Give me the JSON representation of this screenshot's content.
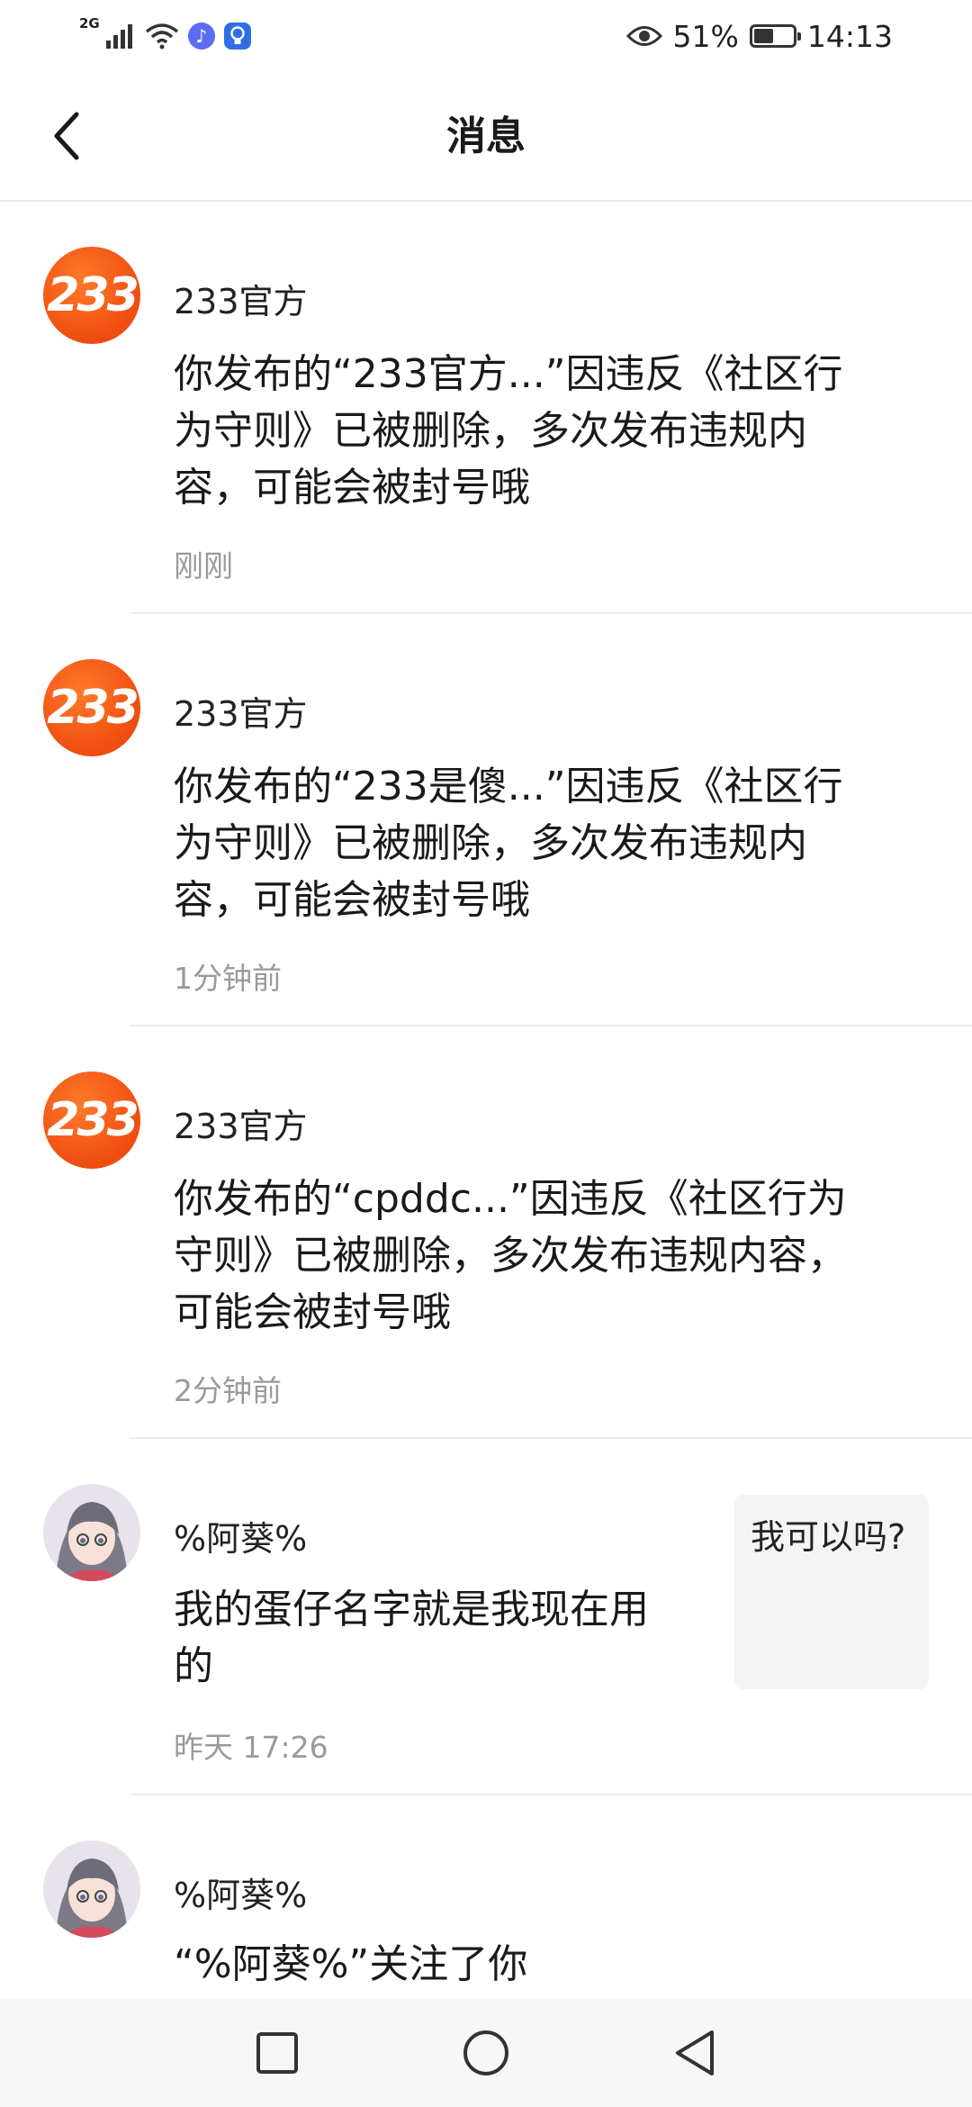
{
  "status_bar": {
    "network": "2G",
    "battery_percent": "51%",
    "battery_level": 0.51,
    "time": "14:13"
  },
  "header": {
    "title": "消息"
  },
  "messages": [
    {
      "avatar_text": "233",
      "sender": "233官方",
      "content": "你发布的“233官方...”因违反《社区行为守则》已被删除，多次发布违规内容，可能会被封号哦",
      "time": "刚刚"
    },
    {
      "avatar_text": "233",
      "sender": "233官方",
      "content": "你发布的“233是傻...”因违反《社区行为守则》已被删除，多次发布违规内容，可能会被封号哦",
      "time": "1分钟前"
    },
    {
      "avatar_text": "233",
      "sender": "233官方",
      "content": "你发布的“cpddc...”因违反《社区行为守则》已被删除，多次发布违规内容，可能会被封号哦",
      "time": "2分钟前"
    },
    {
      "sender": "%阿葵%",
      "content": "我的蛋仔名字就是我现在用的",
      "time": "昨天 17:26",
      "reply_preview": "我可以吗?"
    },
    {
      "sender": "%阿葵%",
      "content": "“%阿葵%”关注了你"
    }
  ],
  "icons": {
    "back": "chevron-left-icon",
    "nav_recent": "square-icon",
    "nav_home": "circle-icon",
    "nav_back": "triangle-back-icon"
  }
}
